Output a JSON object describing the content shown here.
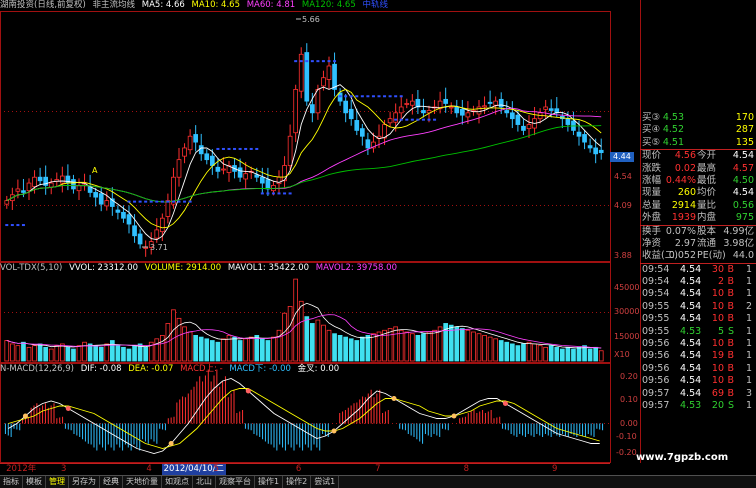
{
  "colors": {
    "up": "#ff3030",
    "down": "#30c0ff",
    "grid": "#a01010",
    "ma5": "#ffffff",
    "ma10": "#ffff00",
    "ma60": "#ff40ff",
    "ma120": "#00c000",
    "blue_dash": "#3050ff",
    "vol_cyan": "#40e0f0",
    "diff": "#ffffff",
    "dea": "#ffff00"
  },
  "main_header": {
    "title": "湖南投资(日线,前复权)",
    "indicator": "非主流均线",
    "ma5": "MA5: 4.66",
    "ma10": "MA10: 4.65",
    "ma60": "MA60: 4.81",
    "ma120": "MA120: 4.65",
    "extra": "中轨线"
  },
  "main_axis": {
    "top": "",
    "p454": "4.54",
    "p409": "4.09",
    "p388": "3.88"
  },
  "annotations": {
    "high": "5.66",
    "low": "3.71",
    "marker_a": "A"
  },
  "price_tag": "4.44",
  "vol_header": {
    "name": "VOL-TDX(5,10)",
    "vvol": "VVOL: 23312.00",
    "volume": "VOLUME: 2914.00",
    "mavol1": "MAVOL1: 35422.00",
    "mavol2": "MAVOL2: 39758.00"
  },
  "vol_axis": {
    "v45000": "45000",
    "v30000": "30000",
    "v15000": "15000",
    "unit": "X10"
  },
  "macd_header": {
    "name": "N-MACD(12,26,9)",
    "dif": "DIF: -0.08",
    "dea": "DEA: -0.07",
    "macd_up": "MACD上: -",
    "macd_down": "MACD下: -0.00",
    "gold": "金叉: 0.00"
  },
  "macd_axis": {
    "m020": "0.20",
    "m010": "0.10",
    "m000": "0.00",
    "m_010": "-0.10",
    "m_020": "-0.20"
  },
  "order_book": [
    {
      "label": "买③",
      "price": "4.53",
      "vol": "170"
    },
    {
      "label": "买④",
      "price": "4.52",
      "vol": "287"
    },
    {
      "label": "买⑤",
      "price": "4.51",
      "vol": "135"
    }
  ],
  "quotes": [
    {
      "l1": "现价",
      "v1": "4.56",
      "c1": "#ff3030",
      "l2": "今开",
      "v2": "4.54",
      "c2": "#ffffff"
    },
    {
      "l1": "涨跌",
      "v1": "0.02",
      "c1": "#ff3030",
      "l2": "最高",
      "v2": "4.57",
      "c2": "#ff3030"
    },
    {
      "l1": "涨幅",
      "v1": "0.44%",
      "c1": "#ff3030",
      "l2": "最低",
      "v2": "4.50",
      "c2": "#30d030"
    },
    {
      "l1": "现量",
      "v1": "260",
      "c1": "#ffff00",
      "l2": "均价",
      "v2": "4.54",
      "c2": "#ffffff"
    },
    {
      "l1": "总量",
      "v1": "2914",
      "c1": "#ffff00",
      "l2": "量比",
      "v2": "0.56",
      "c2": "#30d030"
    },
    {
      "l1": "外盘",
      "v1": "1939",
      "c1": "#ff3030",
      "l2": "内盘",
      "v2": "975",
      "c2": "#30d030"
    }
  ],
  "stats": [
    {
      "l1": "换手",
      "v1": "0.07%",
      "l2": "股本",
      "v2": "4.99亿"
    },
    {
      "l1": "净资",
      "v1": "2.97",
      "l2": "流通",
      "v2": "3.98亿"
    },
    {
      "l1": "收益(二)",
      "v1": "0.052",
      "l2": "PE(动)",
      "v2": "44.0"
    }
  ],
  "ticks": [
    {
      "time": "09:54",
      "price": "4.54",
      "vol": "30",
      "bs": "B",
      "n": "1"
    },
    {
      "time": "09:54",
      "price": "4.54",
      "vol": "2",
      "bs": "B",
      "n": "1"
    },
    {
      "time": "09:54",
      "price": "4.54",
      "vol": "10",
      "bs": "B",
      "n": "1"
    },
    {
      "time": "09:55",
      "price": "4.54",
      "vol": "10",
      "bs": "B",
      "n": "2"
    },
    {
      "time": "09:55",
      "price": "4.54",
      "vol": "10",
      "bs": "B",
      "n": "1"
    },
    {
      "time": "09:55",
      "price": "4.53",
      "vol": "5",
      "bs": "S",
      "n": "1"
    },
    {
      "time": "09:56",
      "price": "4.54",
      "vol": "10",
      "bs": "B",
      "n": "1"
    },
    {
      "time": "09:56",
      "price": "4.54",
      "vol": "19",
      "bs": "B",
      "n": "1"
    },
    {
      "time": "09:56",
      "price": "4.54",
      "vol": "10",
      "bs": "B",
      "n": "1"
    },
    {
      "time": "09:56",
      "price": "4.54",
      "vol": "10",
      "bs": "B",
      "n": "1"
    },
    {
      "time": "09:57",
      "price": "4.54",
      "vol": "69",
      "bs": "B",
      "n": "3"
    },
    {
      "time": "09:57",
      "price": "4.53",
      "vol": "20",
      "bs": "S",
      "n": "1"
    }
  ],
  "x_labels": [
    {
      "text": "2012年",
      "pos": 0.01
    },
    {
      "text": "3",
      "pos": 0.1
    },
    {
      "text": "4",
      "pos": 0.24
    },
    {
      "text": "2012/04/10/二",
      "pos": 0.265
    },
    {
      "text": "5",
      "pos": 0.35
    },
    {
      "text": "6",
      "pos": 0.485
    },
    {
      "text": "7",
      "pos": 0.615
    },
    {
      "text": "8",
      "pos": 0.76
    },
    {
      "text": "9",
      "pos": 0.905
    }
  ],
  "tabs": [
    "指标",
    "模板",
    "管理",
    "另存为",
    "经典",
    "天地价量",
    "如观点",
    "北山",
    "观察平台",
    "操作1",
    "操作2",
    "尝试1"
  ],
  "active_tab": "管理",
  "watermark": "www.7gpzb.com",
  "chart_data": {
    "type": "candlestick",
    "x_range": [
      "2012-02",
      "2012-09"
    ],
    "price_ylim": [
      3.71,
      5.66
    ],
    "high": 5.66,
    "low": 3.71,
    "price_series": [
      4.15,
      4.2,
      4.25,
      4.22,
      4.3,
      4.35,
      4.32,
      4.28,
      4.3,
      4.33,
      4.36,
      4.3,
      4.25,
      4.28,
      4.3,
      4.22,
      4.18,
      4.12,
      4.15,
      4.1,
      4.05,
      4.0,
      3.95,
      3.85,
      3.78,
      3.75,
      3.8,
      3.9,
      4.0,
      4.15,
      4.35,
      4.5,
      4.6,
      4.7,
      4.65,
      4.55,
      4.5,
      4.45,
      4.4,
      4.42,
      4.45,
      4.4,
      4.35,
      4.38,
      4.4,
      4.35,
      4.3,
      4.25,
      4.28,
      4.35,
      4.45,
      4.7,
      5.1,
      5.4,
      5.0,
      4.9,
      5.1,
      5.2,
      5.3,
      5.1,
      5.0,
      4.9,
      4.85,
      4.75,
      4.7,
      4.6,
      4.65,
      4.7,
      4.8,
      4.85,
      4.9,
      4.95,
      4.98,
      5.0,
      4.95,
      4.9,
      4.92,
      4.95,
      5.0,
      4.98,
      4.95,
      4.9,
      4.88,
      4.9,
      4.92,
      4.95,
      4.96,
      4.98,
      5.0,
      4.95,
      4.9,
      4.85,
      4.8,
      4.75,
      4.8,
      4.85,
      4.9,
      4.95,
      4.92,
      4.9,
      4.85,
      4.8,
      4.75,
      4.7,
      4.65,
      4.6,
      4.55,
      4.56
    ],
    "volume_series": [
      12,
      10,
      9,
      11,
      8,
      9,
      10,
      8,
      7,
      9,
      10,
      8,
      7,
      9,
      11,
      10,
      9,
      8,
      10,
      12,
      9,
      8,
      7,
      9,
      10,
      8,
      11,
      13,
      15,
      22,
      30,
      25,
      20,
      17,
      15,
      14,
      13,
      12,
      11,
      13,
      15,
      14,
      12,
      13,
      14,
      15,
      13,
      12,
      14,
      18,
      28,
      32,
      48,
      35,
      26,
      22,
      24,
      21,
      18,
      16,
      15,
      14,
      13,
      12,
      14,
      15,
      16,
      17,
      18,
      19,
      20,
      18,
      17,
      16,
      15,
      16,
      17,
      18,
      20,
      22,
      21,
      20,
      19,
      18,
      17,
      16,
      15,
      14,
      13,
      12,
      11,
      10,
      9,
      10,
      11,
      10,
      9,
      8,
      9,
      8,
      7,
      8,
      7,
      8,
      9,
      7,
      8,
      6
    ],
    "volume_ylim": [
      0,
      45000
    ],
    "macd_ylim": [
      -0.2,
      0.2
    ],
    "macd_series": [
      -0.02,
      0.0,
      0.03,
      0.06,
      0.08,
      0.09,
      0.08,
      0.06,
      0.04,
      0.02,
      0.0,
      -0.02,
      -0.04,
      -0.06,
      -0.08,
      -0.1,
      -0.11,
      -0.12,
      -0.11,
      -0.08,
      -0.04,
      0.0,
      0.05,
      0.1,
      0.14,
      0.17,
      0.18,
      0.16,
      0.13,
      0.1,
      0.07,
      0.04,
      0.02,
      0.0,
      -0.02,
      -0.04,
      -0.06,
      -0.05,
      -0.03,
      0.0,
      0.03,
      0.06,
      0.1,
      0.13,
      0.12,
      0.1,
      0.08,
      0.06,
      0.04,
      0.03,
      0.02,
      0.02,
      0.03,
      0.05,
      0.07,
      0.09,
      0.1,
      0.1,
      0.08,
      0.06,
      0.04,
      0.02,
      0.0,
      -0.02,
      -0.04,
      -0.05,
      -0.06,
      -0.07,
      -0.08,
      -0.08
    ],
    "dea_series": [
      0.0,
      0.01,
      0.02,
      0.03,
      0.05,
      0.06,
      0.07,
      0.07,
      0.06,
      0.05,
      0.04,
      0.02,
      0.0,
      -0.02,
      -0.04,
      -0.06,
      -0.08,
      -0.09,
      -0.1,
      -0.09,
      -0.08,
      -0.05,
      -0.02,
      0.02,
      0.06,
      0.1,
      0.13,
      0.14,
      0.14,
      0.12,
      0.1,
      0.08,
      0.06,
      0.04,
      0.02,
      0.0,
      -0.02,
      -0.03,
      -0.03,
      -0.02,
      0.0,
      0.02,
      0.05,
      0.08,
      0.1,
      0.1,
      0.09,
      0.08,
      0.07,
      0.05,
      0.04,
      0.03,
      0.03,
      0.04,
      0.05,
      0.07,
      0.08,
      0.09,
      0.09,
      0.08,
      0.06,
      0.04,
      0.02,
      0.0,
      -0.02,
      -0.03,
      -0.04,
      -0.05,
      -0.06,
      -0.07
    ],
    "series": [
      {
        "name": "MA5",
        "color": "#ffffff"
      },
      {
        "name": "MA10",
        "color": "#ffff00"
      },
      {
        "name": "MA60",
        "color": "#ff40ff"
      },
      {
        "name": "MA120",
        "color": "#00c000"
      }
    ]
  }
}
